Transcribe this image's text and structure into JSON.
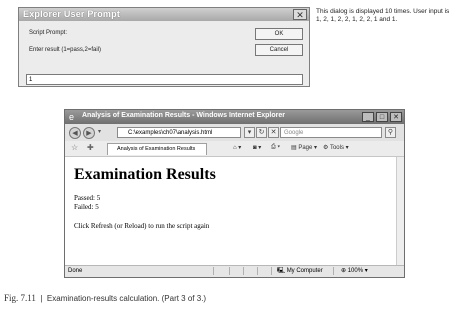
{
  "prompt": {
    "title": "Explorer User Prompt",
    "script_label": "Script Prompt:",
    "message": "Enter result (1=pass,2=fail)",
    "ok_label": "OK",
    "cancel_label": "Cancel",
    "input_value": "1"
  },
  "side_note": "This dialog is displayed 10 times. User input is 1, 2, 1, 2, 2, 1, 2, 2, 1 and 1.",
  "browser": {
    "title": "Analysis of Examination Results - Windows Internet Explorer",
    "address": "C:\\examples\\ch07\\analysis.html",
    "search_placeholder": "Google",
    "tab_label": "Analysis of Examination Results",
    "page_menu": "Page",
    "tools_menu": "Tools",
    "heading": "Examination Results",
    "passed": "Passed: 5",
    "failed": "Failed: 5",
    "instruction": "Click Refresh (or Reload) to run the script again",
    "status_left": "Done",
    "zone": "My Computer",
    "zoom": "100%"
  },
  "caption": {
    "figure": "Fig. 7.11",
    "separator": "|",
    "text": "Examination-results calculation. (Part 3 of 3.)"
  }
}
